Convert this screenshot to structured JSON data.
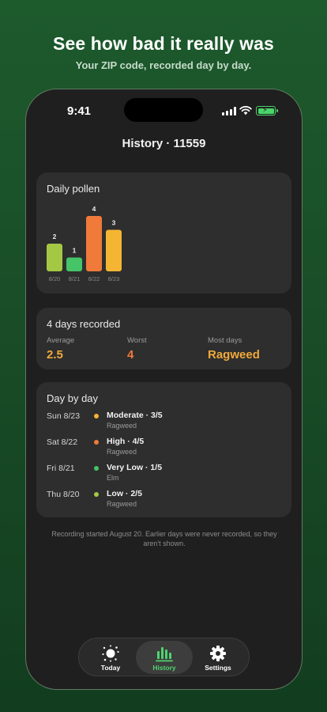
{
  "promo": {
    "title": "See how bad it really was",
    "subtitle": "Your ZIP code, recorded day by day."
  },
  "status_bar": {
    "time": "9:41"
  },
  "header": {
    "title": "History · 11559"
  },
  "daily_pollen": {
    "title": "Daily pollen"
  },
  "chart_data": {
    "type": "bar",
    "categories": [
      "8/20",
      "8/21",
      "8/22",
      "8/23"
    ],
    "values": [
      2,
      1,
      4,
      3
    ],
    "data_labels": [
      "2",
      "1",
      "4",
      "3"
    ],
    "colors": [
      "#a4c843",
      "#45c468",
      "#f07a3a",
      "#f4b632"
    ],
    "title": "Daily pollen",
    "ylim": [
      0,
      4
    ],
    "grid": false,
    "legend": "none"
  },
  "summary": {
    "title": "4 days recorded",
    "average_label": "Average",
    "average_value": "2.5",
    "worst_label": "Worst",
    "worst_value": "4",
    "most_days_label": "Most days",
    "most_days_value": "Ragweed"
  },
  "day_by_day": {
    "title": "Day by day",
    "days": [
      {
        "date": "Sun 8/23",
        "level": "Moderate · 3/5",
        "allergen": "Ragweed",
        "color": "#f4b632"
      },
      {
        "date": "Sat 8/22",
        "level": "High · 4/5",
        "allergen": "Ragweed",
        "color": "#f07a3a"
      },
      {
        "date": "Fri 8/21",
        "level": "Very Low · 1/5",
        "allergen": "Elm",
        "color": "#45c468"
      },
      {
        "date": "Thu 8/20",
        "level": "Low · 2/5",
        "allergen": "Ragweed",
        "color": "#a4c843"
      }
    ]
  },
  "footnote": "Recording started August 20. Earlier days were never recorded, so they aren't shown.",
  "tabs": [
    {
      "label": "Today",
      "icon": "sun-pollen-icon"
    },
    {
      "label": "History",
      "icon": "bar-chart-icon"
    },
    {
      "label": "Settings",
      "icon": "gear-icon"
    }
  ],
  "colors": {
    "accent_green": "#4fd36f",
    "highlight_orange": "#f0a93a",
    "worst_orange": "#f07a3a"
  }
}
